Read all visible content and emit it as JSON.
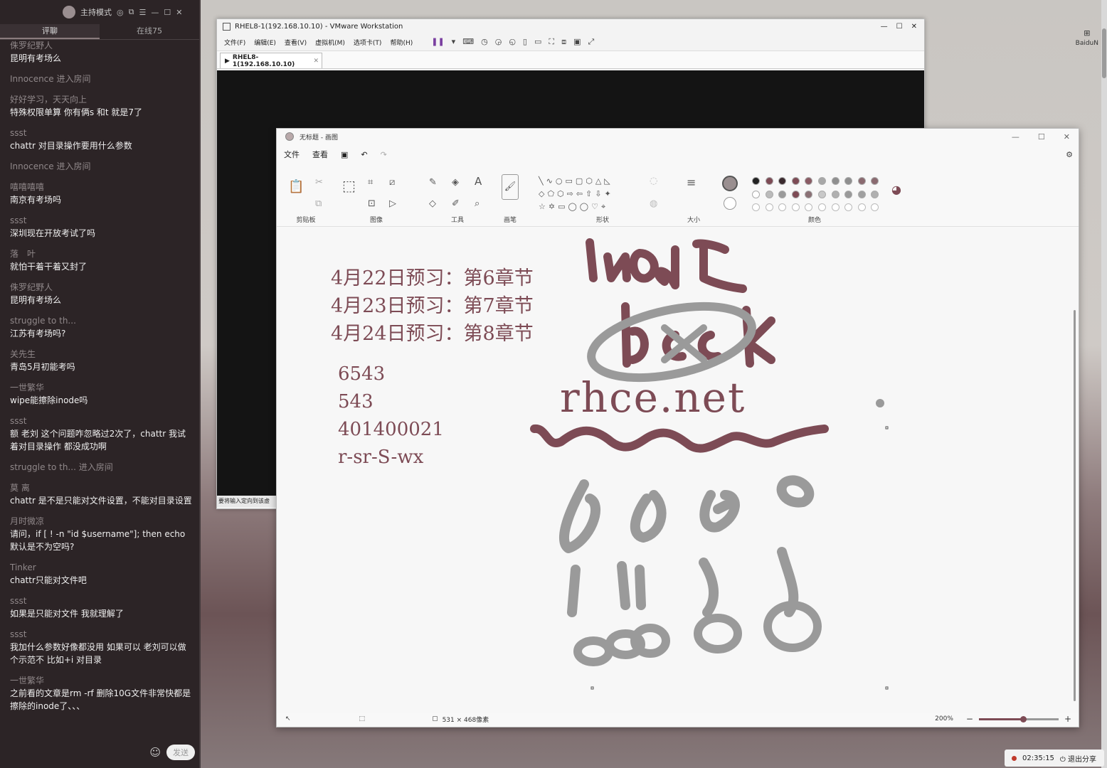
{
  "sidebar": {
    "top_label": "主持模式",
    "tabs": [
      {
        "label": "评聊"
      },
      {
        "label": "在线75"
      }
    ],
    "messages": [
      {
        "user": "侏罗纪野人",
        "text": "昆明有考场么"
      },
      {
        "system": "Innocence 进入房间"
      },
      {
        "user": "好好学习，天天向上",
        "text": "特殊权限单算 你有俩s 和t 就是7了"
      },
      {
        "user": "ssst",
        "text": "chattr 对目录操作要用什么参数"
      },
      {
        "system": "Innocence 进入房间"
      },
      {
        "user": "嘻嘻嘻嘻",
        "text": "南京有考场吗"
      },
      {
        "user": "ssst",
        "text": "深圳现在开放考试了吗"
      },
      {
        "user": "落　叶",
        "text": "就怕干着干着又封了"
      },
      {
        "user": "侏罗纪野人",
        "text": "昆明有考场么"
      },
      {
        "user": "struggle to th...",
        "text": "江苏有考场吗?"
      },
      {
        "user": "关先生",
        "text": "青岛5月初能考吗"
      },
      {
        "user": "一世繁华",
        "text": "wipe能擦除inode吗"
      },
      {
        "user": "ssst",
        "text": "额 老刘 这个问题咋忽略过2次了，chattr 我试着对目录操作 都没成功啊"
      },
      {
        "system": "struggle to th... 进入房间"
      },
      {
        "user": "莫 离",
        "text": "chattr 是不是只能对文件设置，不能对目录设置"
      },
      {
        "user": "月时微凉",
        "text": "请问，if [ ! -n \"id $username\"]; then echo 默认是不为空吗?"
      },
      {
        "user": "Tinker",
        "text": "chattr只能对文件吧"
      },
      {
        "user": "ssst",
        "text": "如果是只能对文件 我就理解了"
      },
      {
        "user": "ssst",
        "text": "我加什么参数好像都没用 如果可以 老刘可以做个示范不 比如+i 对目录"
      },
      {
        "user": "一世繁华",
        "text": "之前看的文章是rm -rf 删除10G文件非常快都是擦除的inode了、、、"
      }
    ],
    "send_label": "发送"
  },
  "vmware": {
    "title": "RHEL8-1(192.168.10.10) - VMware Workstation",
    "menu": [
      "文件(F)",
      "编辑(E)",
      "查看(V)",
      "虚拟机(M)",
      "选项卡(T)",
      "帮助(H)"
    ],
    "tab": "RHEL8-1(192.168.10.10)",
    "status_text": "要将输入定向到该虚"
  },
  "paint": {
    "title": "无标题 - 画图",
    "menu": [
      "文件",
      "查看"
    ],
    "ribbon_groups": {
      "clipboard": "剪贴板",
      "image": "图像",
      "tools": "工具",
      "brushes": "画笔",
      "shapes": "形状",
      "size": "大小",
      "colors": "颜色"
    },
    "notes": {
      "line1": "4月22日预习：第6章节",
      "line2": "4月23日预习：第7章节",
      "line3": "4月24日预习：第8章节",
      "n1": "6543",
      "n2": "543",
      "n3": "401400021",
      "n4": "r-sr-S-wx",
      "site": "rhce.net"
    },
    "dimensions": "531 × 468像素",
    "zoom": "200%",
    "palette_primary": "#7d4b55",
    "palette_grey": "#9a9a9a"
  },
  "taskbar": {
    "timer": "02:35:15",
    "exit_share": "退出分享"
  },
  "corner": {
    "label": "BaiduN"
  }
}
